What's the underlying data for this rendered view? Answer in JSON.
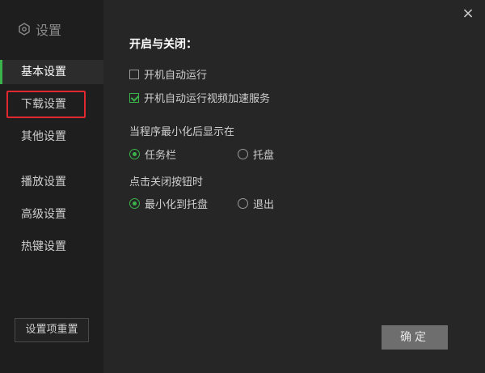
{
  "sidebar": {
    "title": "设置",
    "items": [
      {
        "label": "基本设置"
      },
      {
        "label": "下载设置"
      },
      {
        "label": "其他设置"
      },
      {
        "label": "播放设置"
      },
      {
        "label": "高级设置"
      },
      {
        "label": "热键设置"
      }
    ],
    "reset_label": "设置项重置"
  },
  "close_label": "×",
  "main": {
    "section_title": "开启与关闭：",
    "options": [
      {
        "label": "开机自动运行",
        "checked": false
      },
      {
        "label": "开机自动运行视频加速服务",
        "checked": true
      }
    ],
    "minimize_label": "当程序最小化后显示在",
    "minimize_options": [
      {
        "label": "任务栏",
        "selected": true
      },
      {
        "label": "托盘",
        "selected": false
      }
    ],
    "close_button_label": "点击关闭按钮时",
    "close_options": [
      {
        "label": "最小化到托盘",
        "selected": true
      },
      {
        "label": "退出",
        "selected": false
      }
    ],
    "ok_label": "确定"
  },
  "colors": {
    "accent": "#3ab34a",
    "highlight": "#e0282e"
  }
}
